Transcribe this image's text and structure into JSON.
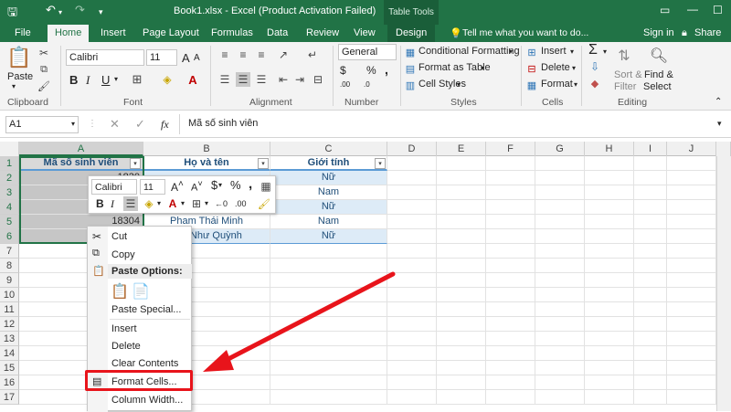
{
  "window": {
    "title": "Book1.xlsx - Excel (Product Activation Failed)",
    "table_tools": "Table Tools",
    "sign_in": "Sign in",
    "share": "Share",
    "tell_me": "Tell me what you want to do..."
  },
  "tabs": [
    "File",
    "Home",
    "Insert",
    "Page Layout",
    "Formulas",
    "Data",
    "Review",
    "View",
    "Design"
  ],
  "ribbon": {
    "paste": "Paste",
    "clipboard": "Clipboard",
    "font_name": "Calibri",
    "font_size": "11",
    "font": "Font",
    "alignment": "Alignment",
    "number_format": "General",
    "number": "Number",
    "conditional_formatting": "Conditional Formatting",
    "format_as_table": "Format as Table",
    "cell_styles": "Cell Styles",
    "styles": "Styles",
    "insert": "Insert",
    "delete": "Delete",
    "format": "Format",
    "cells": "Cells",
    "sort_filter_1": "Sort &",
    "sort_filter_2": "Filter",
    "find_select_1": "Find &",
    "find_select_2": "Select",
    "editing": "Editing",
    "bold": "B",
    "italic": "I",
    "underline": "U",
    "font_grow": "A",
    "font_shrink": "A",
    "percent": "%",
    "comma": ",",
    "currency": "$",
    "decimal_inc": ".00",
    "decimal_dec": ".0",
    "sigma": "Σ"
  },
  "formula_bar": {
    "name_box": "A1",
    "fx": "fx",
    "content": "Mã số sinh viên"
  },
  "columns": [
    "A",
    "B",
    "C",
    "D",
    "E",
    "F",
    "G",
    "H",
    "I",
    "J"
  ],
  "rows": [
    "1",
    "2",
    "3",
    "4",
    "5",
    "6",
    "7",
    "8",
    "9",
    "10",
    "11",
    "12",
    "13",
    "14",
    "15",
    "16",
    "17"
  ],
  "table": {
    "headers": [
      "Mã số sinh viên",
      "Họ và tên",
      "Giới tính"
    ],
    "col_a": [
      "1830",
      "1830",
      "1830",
      "18304",
      "1830"
    ],
    "col_b": [
      "",
      "",
      "",
      "Pham Thái Minh",
      "gọc Như Quỳnh"
    ],
    "col_c": [
      "Nữ",
      "Nam",
      "Nữ",
      "Nam",
      "Nữ"
    ]
  },
  "mini_toolbar": {
    "font": "Calibri",
    "size": "11",
    "bold": "B",
    "italic": "I",
    "percent": "%",
    "comma": ",",
    "currency": "$"
  },
  "context_menu": {
    "cut": "Cut",
    "copy": "Copy",
    "paste_options": "Paste Options:",
    "paste_special": "Paste Special...",
    "insert": "Insert",
    "delete": "Delete",
    "clear_contents": "Clear Contents",
    "format_cells": "Format Cells...",
    "column_width": "Column Width..."
  },
  "colors": {
    "excel_green": "#217346",
    "highlight_red": "#e8141b",
    "table_header_blue": "#1f4e79",
    "band_blue": "#ddebf7"
  }
}
